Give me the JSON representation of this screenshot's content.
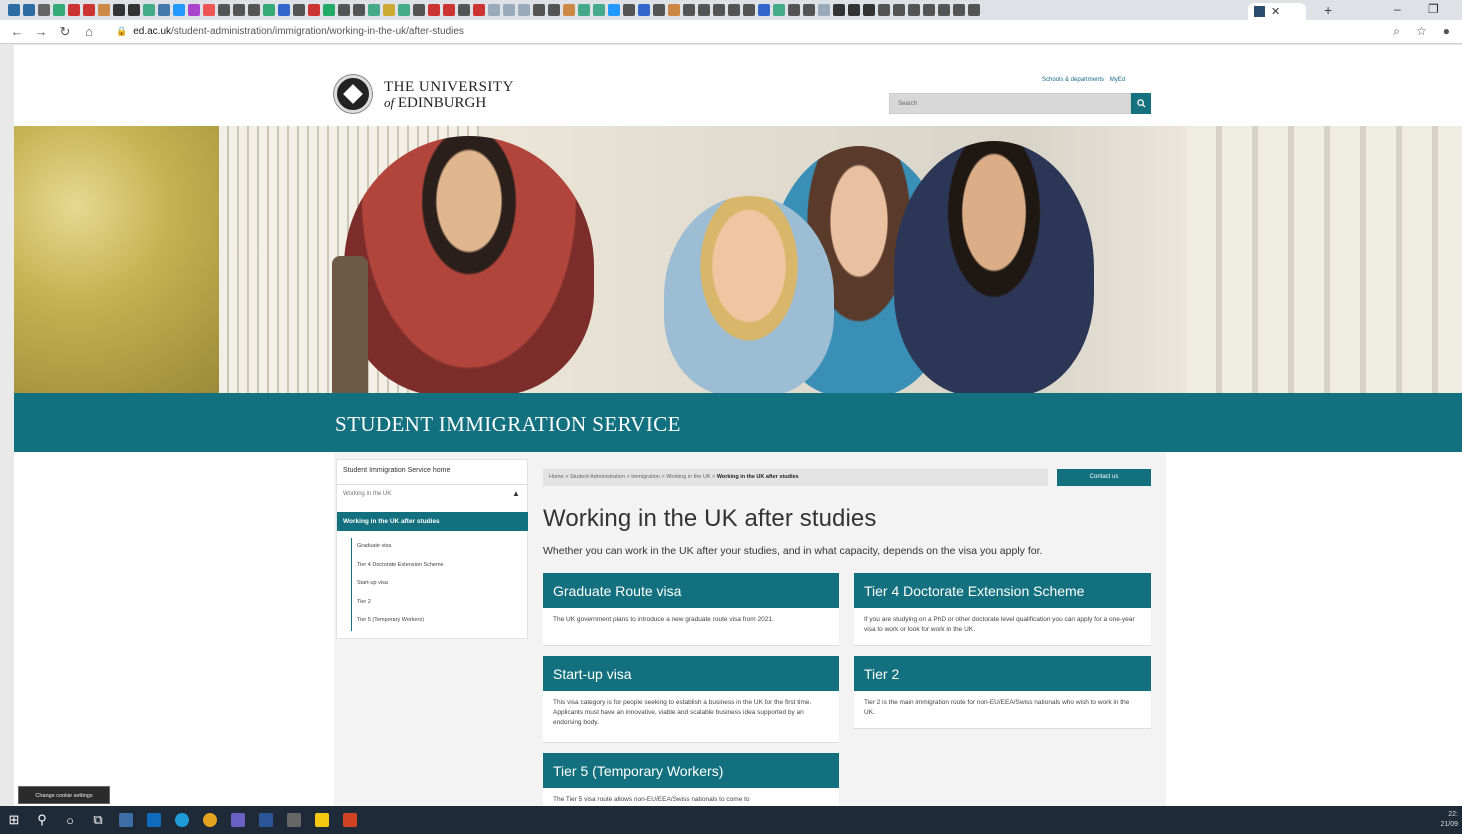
{
  "browser": {
    "url_domain": "ed.ac.uk",
    "url_path": "/student-administration/immigration/working-in-the-uk/after-studies",
    "tab_colors": [
      "#2c6ca3",
      "#2c6ca3",
      "#666",
      "#3a7",
      "#c33",
      "#c33",
      "#c84",
      "#333",
      "#333",
      "#4a8",
      "#47a",
      "#29f",
      "#a4c",
      "#e55",
      "#555",
      "#555",
      "#555",
      "#3a7",
      "#36c",
      "#555",
      "#c33",
      "#2a6",
      "#555",
      "#555",
      "#4a8",
      "#ca3",
      "#4a8",
      "#555",
      "#c33",
      "#c33",
      "#555",
      "#c33",
      "#9ab",
      "#9ab",
      "#9ab",
      "#555",
      "#555",
      "#c84",
      "#4a8",
      "#4a8",
      "#29f",
      "#555",
      "#36c",
      "#555",
      "#c84",
      "#555",
      "#555",
      "#555",
      "#555",
      "#555",
      "#36c",
      "#4a8",
      "#555",
      "#555",
      "#9ab",
      "#333",
      "#333",
      "#333",
      "#555",
      "#555",
      "#555",
      "#555",
      "#555",
      "#555",
      "#555"
    ]
  },
  "header": {
    "logo_line1": "THE UNIVERSITY",
    "logo_of": "of",
    "logo_line2": "EDINBURGH",
    "link_schools": "Schools & departments",
    "link_myed": "MyEd",
    "search_placeholder": "Search"
  },
  "banner": {
    "title": "STUDENT IMMIGRATION SERVICE"
  },
  "sidenav": {
    "home": "Student Immigration Service home",
    "section": "Working in the UK",
    "active": "Working in the UK after studies",
    "items": [
      "Graduate visa",
      "Tier 4 Doctorate Extension Scheme",
      "Start-up visa",
      "Tier 2",
      "Tier 5 (Temporary Workers)"
    ]
  },
  "breadcrumb": {
    "items": [
      "Home",
      "Student Administration",
      "Immigration",
      "Working in the UK"
    ],
    "current": "Working in the UK after studies",
    "separator": ">"
  },
  "contact_label": "Contact us",
  "main": {
    "title": "Working in the UK after studies",
    "lead": "Whether you can work in the UK after your studies, and in what capacity, depends on the visa you apply for.",
    "cards": [
      {
        "title": "Graduate Route visa",
        "body": "The UK government plans to introduce a new graduate route visa from 2021."
      },
      {
        "title": "Tier 4 Doctorate Extension Scheme",
        "body": "If you are studying on a PhD or other doctorate level qualification you can apply for a one-year visa to work or look for work in the UK."
      },
      {
        "title": "Start-up visa",
        "body": "This visa category is for people seeking to establish a business in the UK for the first time. Applicants must have an innovative, viable and scalable business idea supported by an endorsing body."
      },
      {
        "title": "Tier 2",
        "body": "Tier 2 is the main immigration route for non-EU/EEA/Swiss nationals who wish to work in the UK."
      },
      {
        "title": "Tier 5 (Temporary Workers)",
        "body": "The Tier 5 visa route allows non-EU/EEA/Swiss nationals to come to"
      }
    ]
  },
  "cookie_label": "Change cookie settings",
  "clock": {
    "time": "22:",
    "date": "21/09"
  },
  "colors": {
    "accent": "#13717f"
  }
}
